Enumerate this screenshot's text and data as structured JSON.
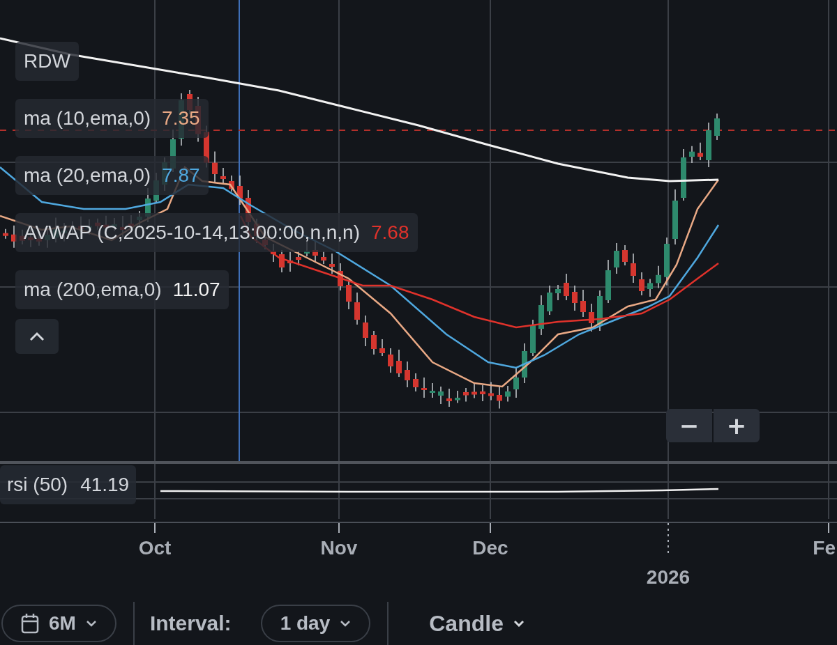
{
  "symbol": "RDW",
  "indicators": [
    {
      "label": "ma (10,ema,0)",
      "value": "7.35",
      "color": "#e9a985"
    },
    {
      "label": "ma (20,ema,0)",
      "value": "7.87",
      "color": "#4fa8df"
    },
    {
      "label": "AVWAP (C,2025-10-14,13:00:00,n,n,n)",
      "value": "7.68",
      "color": "#e0322b"
    },
    {
      "label": "ma (200,ema,0)",
      "value": "11.07",
      "color": "#f2f2f2"
    }
  ],
  "zoom_controls": [
    "−",
    "+"
  ],
  "rsi": {
    "label": "rsi (50)",
    "value": "41.19"
  },
  "x_axis": [
    {
      "label": "Oct",
      "kind": "month"
    },
    {
      "label": "Nov",
      "kind": "month"
    },
    {
      "label": "Dec",
      "kind": "month"
    },
    {
      "label": "2026",
      "kind": "year"
    },
    {
      "label": "Fe",
      "kind": "month"
    }
  ],
  "toolbar": {
    "range": "6M",
    "interval_label": "Interval:",
    "interval": "1 day",
    "chart_type": "Candle"
  }
}
